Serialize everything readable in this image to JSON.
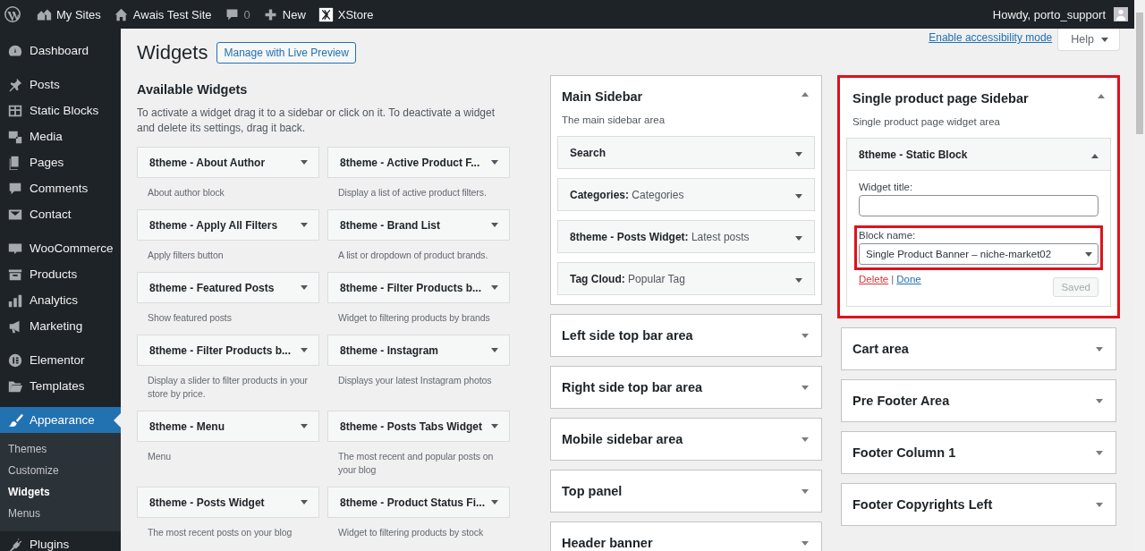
{
  "admin_bar": {
    "items": [
      {
        "label": "My Sites",
        "kind": "link"
      },
      {
        "label": "Awais Test Site",
        "kind": "link"
      },
      {
        "label": "0",
        "kind": "count"
      },
      {
        "label": "New",
        "kind": "link"
      },
      {
        "label": "XStore",
        "kind": "link"
      }
    ],
    "account": "Howdy, porto_support"
  },
  "menu_groups": [
    [
      {
        "label": "Dashboard",
        "selected": false
      }
    ],
    [
      {
        "label": "Posts",
        "selected": false
      },
      {
        "label": "Static Blocks",
        "selected": false
      },
      {
        "label": "Media",
        "selected": false
      },
      {
        "label": "Pages",
        "selected": false
      },
      {
        "label": "Comments",
        "selected": false
      },
      {
        "label": "Contact",
        "selected": false
      }
    ],
    [
      {
        "label": "WooCommerce",
        "selected": false
      },
      {
        "label": "Products",
        "selected": false
      },
      {
        "label": "Analytics",
        "selected": false
      },
      {
        "label": "Marketing",
        "selected": false
      }
    ],
    [
      {
        "label": "Elementor",
        "selected": false
      },
      {
        "label": "Templates",
        "selected": false
      }
    ],
    [
      {
        "label": "Appearance",
        "selected": true,
        "submenu": [
          {
            "label": "Themes",
            "selected": false
          },
          {
            "label": "Customize",
            "selected": false
          },
          {
            "label": "Widgets",
            "selected": true
          },
          {
            "label": "Menus",
            "selected": false
          }
        ]
      },
      {
        "label": "Plugins",
        "selected": false
      }
    ]
  ],
  "page": {
    "title": "Widgets",
    "live_preview_button": "Manage with Live Preview",
    "accessibility_link": "Enable accessibility mode",
    "help_button": "Help"
  },
  "available": {
    "title": "Available Widgets",
    "description": "To activate a widget drag it to a sidebar or click on it. To deactivate a widget and delete its settings, drag it back.",
    "widgets": [
      {
        "title": "8theme - About Author",
        "description": "About author block"
      },
      {
        "title": "8theme - Active Product F...",
        "description": "Display a list of active product filters."
      },
      {
        "title": "8theme - Apply All Filters",
        "description": "Apply filters button"
      },
      {
        "title": "8theme - Brand List",
        "description": "A list or dropdown of product brands."
      },
      {
        "title": "8theme - Featured Posts",
        "description": "Show featured posts"
      },
      {
        "title": "8theme - Filter Products b...",
        "description": "Widget to filtering products by brands"
      },
      {
        "title": "8theme - Filter Products b...",
        "description": "Display a slider to filter products in your store by price."
      },
      {
        "title": "8theme - Instagram",
        "description": "Displays your latest Instagram photos"
      },
      {
        "title": "8theme - Menu",
        "description": "Menu"
      },
      {
        "title": "8theme - Posts Tabs Widget",
        "description": "The most recent and popular posts on your blog"
      },
      {
        "title": "8theme - Posts Widget",
        "description": "The most recent posts on your blog"
      },
      {
        "title": "8theme - Product Status Fi...",
        "description": "Widget to filtering products by stock"
      }
    ]
  },
  "sidebar_columns": [
    [
      {
        "title": "Main Sidebar",
        "description": "The main sidebar area",
        "expanded": true,
        "highlighted": false,
        "widgets": [
          {
            "name": "Search",
            "expanded": false
          },
          {
            "name": "Categories:",
            "title": "Categories",
            "expanded": false
          },
          {
            "name": "8theme - Posts Widget:",
            "title": "Latest posts",
            "expanded": false
          },
          {
            "name": "Tag Cloud:",
            "title": "Popular Tag",
            "expanded": false
          }
        ]
      },
      {
        "title": "Left side top bar area",
        "expanded": false,
        "highlighted": false
      },
      {
        "title": "Right side top bar area",
        "expanded": false,
        "highlighted": false
      },
      {
        "title": "Mobile sidebar area",
        "expanded": false,
        "highlighted": false
      },
      {
        "title": "Top panel",
        "expanded": false,
        "highlighted": false
      },
      {
        "title": "Header banner",
        "expanded": false,
        "highlighted": false
      }
    ],
    [
      {
        "title": "Single product page Sidebar",
        "description": "Single product page widget area",
        "expanded": true,
        "highlighted": true,
        "widgets": [
          {
            "name": "8theme - Static Block",
            "expanded": true,
            "form": {
              "fields": [
                {
                  "kind": "text",
                  "label": "Widget title:",
                  "highlighted": false
                },
                {
                  "kind": "select",
                  "label": "Block name:",
                  "value": "Single Product Banner – niche-market02",
                  "highlighted": true
                }
              ],
              "delete_link": "Delete",
              "separator": "|",
              "done_link": "Done",
              "save_button": {
                "label": "Saved",
                "disabled": true
              }
            }
          }
        ]
      },
      {
        "title": "Cart area",
        "expanded": false,
        "highlighted": false
      },
      {
        "title": "Pre Footer Area",
        "expanded": false,
        "highlighted": false
      },
      {
        "title": "Footer Column 1",
        "expanded": false,
        "highlighted": false
      },
      {
        "title": "Footer Copyrights Left",
        "expanded": false,
        "highlighted": false
      }
    ]
  ]
}
